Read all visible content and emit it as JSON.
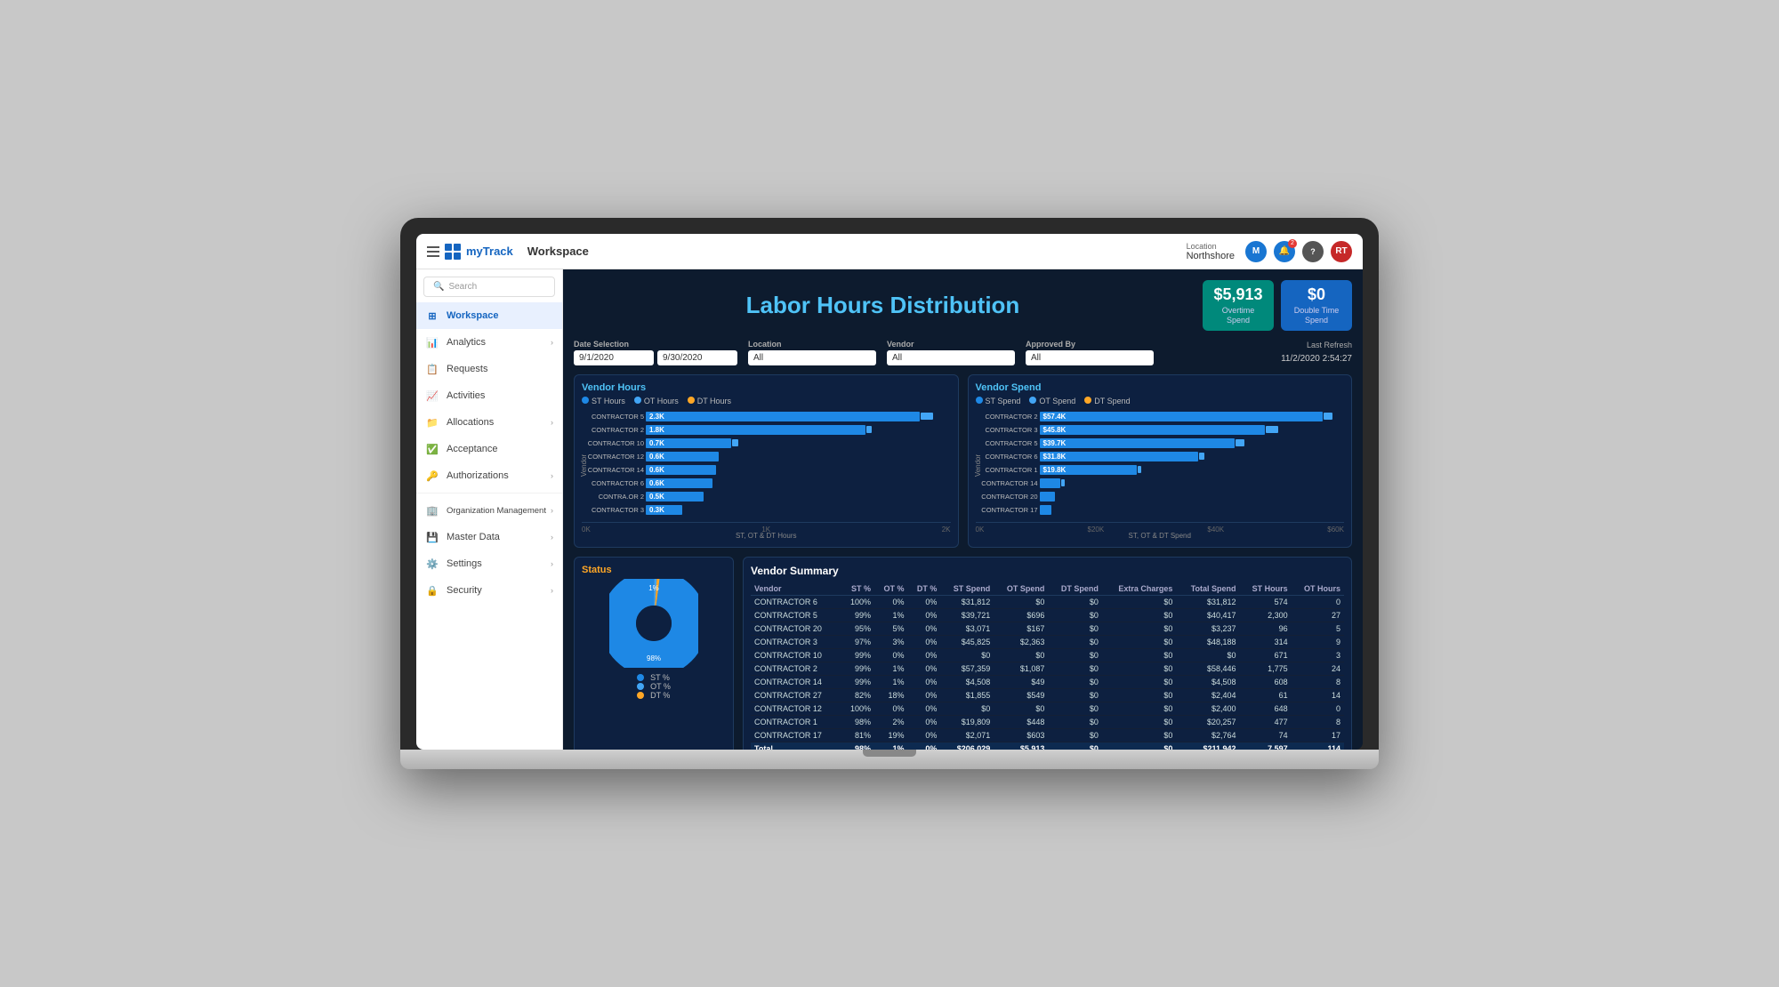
{
  "app": {
    "name": "myTrack",
    "title": "Workspace",
    "logo_icon": "grid-icon"
  },
  "topbar": {
    "location_label": "Location",
    "location_value": "Northshore",
    "avatar_m": "M",
    "avatar_rt": "RT",
    "notif_count": "2",
    "help_label": "?"
  },
  "sidebar": {
    "search_placeholder": "Search",
    "items": [
      {
        "id": "workspace",
        "label": "Workspace",
        "icon": "workspace-icon",
        "active": true
      },
      {
        "id": "analytics",
        "label": "Analytics",
        "icon": "analytics-icon",
        "active": false,
        "has_chevron": true
      },
      {
        "id": "requests",
        "label": "Requests",
        "icon": "requests-icon",
        "active": false
      },
      {
        "id": "activities",
        "label": "Activities",
        "icon": "activities-icon",
        "active": false
      },
      {
        "id": "allocations",
        "label": "Allocations",
        "icon": "allocations-icon",
        "active": false,
        "has_chevron": true
      },
      {
        "id": "acceptance",
        "label": "Acceptance",
        "icon": "acceptance-icon",
        "active": false
      },
      {
        "id": "authorizations",
        "label": "Authorizations",
        "icon": "authorizations-icon",
        "active": false,
        "has_chevron": true
      },
      {
        "id": "org-management",
        "label": "Organization Management",
        "icon": "org-icon",
        "active": false,
        "has_chevron": true
      },
      {
        "id": "master-data",
        "label": "Master Data",
        "icon": "masterdata-icon",
        "active": false,
        "has_chevron": true
      },
      {
        "id": "settings",
        "label": "Settings",
        "icon": "settings-icon",
        "active": false,
        "has_chevron": true
      },
      {
        "id": "security",
        "label": "Security",
        "icon": "security-icon",
        "active": false,
        "has_chevron": true
      }
    ]
  },
  "dashboard": {
    "title": "Labor Hours Distribution",
    "kpi": {
      "overtime": {
        "value": "$5,913",
        "label": "Overtime\nSpend",
        "color": "green"
      },
      "doubletime": {
        "value": "$0",
        "label": "Double Time\nSpend",
        "color": "blue"
      }
    },
    "filters": {
      "date_selection_label": "Date Selection",
      "date_from": "9/1/2020",
      "date_to": "9/30/2020",
      "location_label": "Location",
      "location_value": "All",
      "vendor_label": "Vendor",
      "vendor_value": "All",
      "approved_by_label": "Approved By",
      "approved_by_value": "All",
      "last_refresh_label": "Last Refresh",
      "last_refresh_value": "11/2/2020  2:54:27"
    },
    "vendor_hours_chart": {
      "title": "Vendor Hours",
      "legend": [
        "ST Hours",
        "OT Hours",
        "DT Hours"
      ],
      "x_axis": [
        "0K",
        "1K",
        "2K"
      ],
      "y_label": "Vendor",
      "x_label": "ST, OT & DT Hours",
      "bars": [
        {
          "label": "CONTRACTOR 5",
          "st": 90,
          "st_val": "2.3K",
          "ot": 5,
          "dt": 0
        },
        {
          "label": "CONTRACTOR 2",
          "st": 70,
          "st_val": "1.8K",
          "ot": 3,
          "dt": 0
        },
        {
          "label": "CONTRACTOR 10",
          "st": 28,
          "st_val": "0.7K",
          "ot": 2,
          "dt": 0
        },
        {
          "label": "CONTRACTOR 12",
          "st": 24,
          "st_val": "0.6K",
          "ot": 1,
          "dt": 0
        },
        {
          "label": "CONTRACTOR 14",
          "st": 23,
          "st_val": "0.6K",
          "ot": 1,
          "dt": 0
        },
        {
          "label": "CONTRACTOR 6",
          "st": 23,
          "st_val": "0.6K",
          "ot": 1,
          "dt": 0
        },
        {
          "label": "CONTRACTOR 2",
          "st": 20,
          "st_val": "0.5K",
          "ot": 1,
          "dt": 0
        },
        {
          "label": "CONTRACTOR 3",
          "st": 12,
          "st_val": "0.3K",
          "ot": 0,
          "dt": 0
        }
      ]
    },
    "vendor_spend_chart": {
      "title": "Vendor Spend",
      "legend": [
        "ST Spend",
        "OT Spend",
        "DT Spend"
      ],
      "x_axis": [
        "0K",
        "$20K",
        "$40K",
        "$60K"
      ],
      "y_label": "Vendor",
      "x_label": "ST, OT & DT Spend",
      "bars": [
        {
          "label": "CONTRACTOR 2",
          "st": 95,
          "st_val": "$57.4K",
          "ot": 3,
          "dt": 0
        },
        {
          "label": "CONTRACTOR 3",
          "st": 76,
          "st_val": "$45.8K",
          "ot": 4,
          "dt": 0
        },
        {
          "label": "CONTRACTOR 5",
          "st": 66,
          "st_val": "$39.7K",
          "ot": 3,
          "dt": 0
        },
        {
          "label": "CONTRACTOR 6",
          "st": 53,
          "st_val": "$31.8K",
          "ot": 2,
          "dt": 0
        },
        {
          "label": "CONTRACTOR 1",
          "st": 33,
          "st_val": "$19.8K",
          "ot": 1,
          "dt": 0
        },
        {
          "label": "CONTRACTOR 14",
          "st": 7,
          "st_val": "",
          "ot": 1,
          "dt": 0
        },
        {
          "label": "CONTRACTOR 20",
          "st": 4,
          "st_val": "",
          "ot": 0,
          "dt": 0
        },
        {
          "label": "CONTRACTOR 17",
          "st": 3,
          "st_val": "",
          "ot": 0,
          "dt": 0
        }
      ]
    },
    "status": {
      "title": "Status",
      "pie_st_pct": 98,
      "pie_ot_pct": 1,
      "pie_dt_pct": 1,
      "legend": [
        {
          "label": "ST %",
          "color": "#1e88e5"
        },
        {
          "label": "OT %",
          "color": "#42a5f5"
        },
        {
          "label": "DT %",
          "color": "#ffa726"
        }
      ]
    },
    "summary_table": {
      "title": "Vendor Summary",
      "headers": [
        "Vendor",
        "ST %",
        "OT %",
        "DT %",
        "ST Spend",
        "OT Spend",
        "DT Spend",
        "Extra Charges",
        "Total Spend",
        "ST Hours",
        "OT Hours"
      ],
      "rows": [
        [
          "CONTRACTOR 6",
          "100%",
          "0%",
          "0%",
          "$31,812",
          "$0",
          "$0",
          "$0",
          "$31,812",
          "574",
          "0"
        ],
        [
          "CONTRACTOR 5",
          "99%",
          "1%",
          "0%",
          "$39,721",
          "$696",
          "$0",
          "$0",
          "$40,417",
          "2,300",
          "27"
        ],
        [
          "CONTRACTOR 20",
          "95%",
          "5%",
          "0%",
          "$3,071",
          "$167",
          "$0",
          "$0",
          "$3,237",
          "96",
          "5"
        ],
        [
          "CONTRACTOR 3",
          "97%",
          "3%",
          "0%",
          "$45,825",
          "$2,363",
          "$0",
          "$0",
          "$48,188",
          "314",
          "9"
        ],
        [
          "CONTRACTOR 10",
          "99%",
          "0%",
          "0%",
          "$0",
          "$0",
          "$0",
          "$0",
          "$0",
          "671",
          "3"
        ],
        [
          "CONTRACTOR 2",
          "99%",
          "1%",
          "0%",
          "$57,359",
          "$1,087",
          "$0",
          "$0",
          "$58,446",
          "1,775",
          "24"
        ],
        [
          "CONTRACTOR 14",
          "99%",
          "1%",
          "0%",
          "$4,508",
          "$49",
          "$0",
          "$0",
          "$4,508",
          "608",
          "8"
        ],
        [
          "CONTRACTOR 27",
          "82%",
          "18%",
          "0%",
          "$1,855",
          "$549",
          "$0",
          "$0",
          "$2,404",
          "61",
          "14"
        ],
        [
          "CONTRACTOR 12",
          "100%",
          "0%",
          "0%",
          "$0",
          "$0",
          "$0",
          "$0",
          "$2,400",
          "648",
          "0"
        ],
        [
          "CONTRACTOR 1",
          "98%",
          "2%",
          "0%",
          "$19,809",
          "$448",
          "$0",
          "$0",
          "$20,257",
          "477",
          "8"
        ],
        [
          "CONTRACTOR 17",
          "81%",
          "19%",
          "0%",
          "$2,071",
          "$603",
          "$0",
          "$0",
          "$2,764",
          "74",
          "17"
        ],
        [
          "Total",
          "98%",
          "1%",
          "0%",
          "$206,029",
          "$5,913",
          "$0",
          "$0",
          "$211,942",
          "7,597",
          "114"
        ]
      ]
    }
  }
}
